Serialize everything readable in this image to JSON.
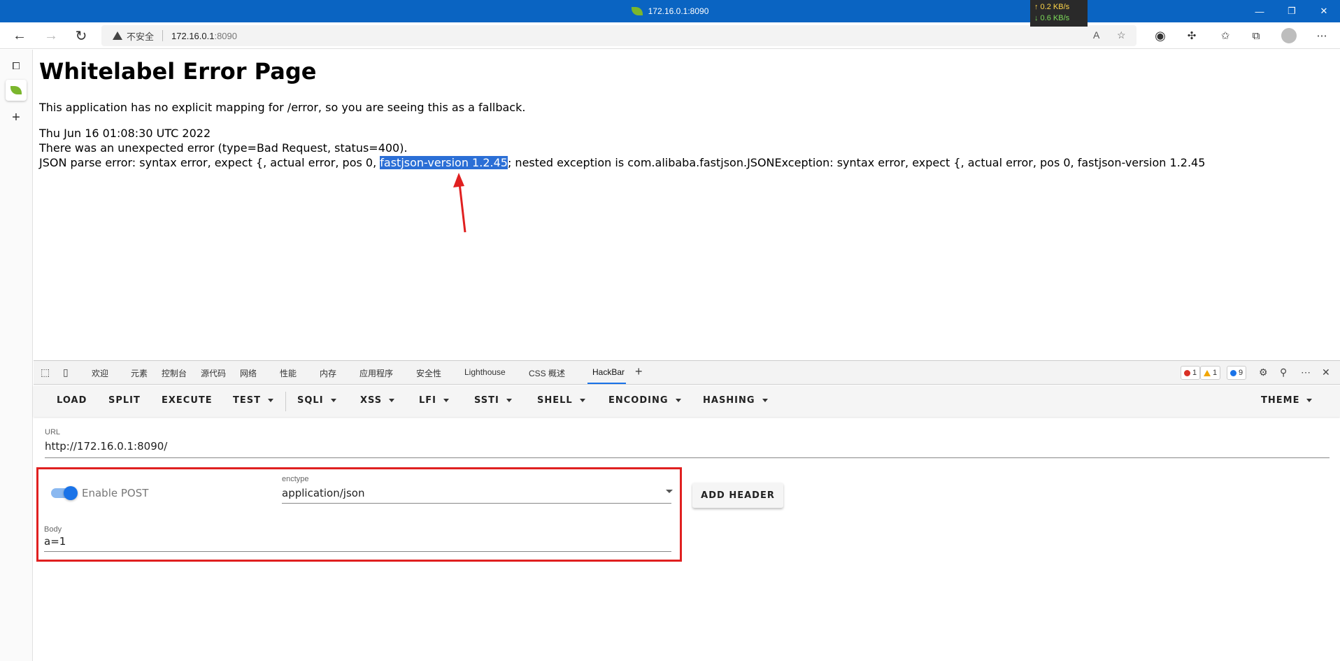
{
  "window": {
    "title": "172.16.0.1:8090",
    "net_up": "↑ 0.2 KB/s",
    "net_down": "↓ 0.6 KB/s",
    "minimize": "—",
    "restore": "❐",
    "close": "✕"
  },
  "addressbar": {
    "back": "←",
    "forward": "→",
    "reload": "↻",
    "insecure_label": "不安全",
    "url_host": "172.16.0.1",
    "url_port": ":8090"
  },
  "sidebar": {
    "add": "+"
  },
  "page": {
    "heading": "Whitelabel Error Page",
    "fallback_msg": "This application has no explicit mapping for /error, so you are seeing this as a fallback.",
    "timestamp": "Thu Jun 16 01:08:30 UTC 2022",
    "error_line": "There was an unexpected error (type=Bad Request, status=400).",
    "json_error_prefix": "JSON parse error: syntax error, expect {, actual error, pos 0, ",
    "json_error_highlight": "fastjson-version 1.2.45",
    "json_error_suffix": "; nested exception is com.alibaba.fastjson.JSONException: syntax error, expect {, actual error, pos 0, fastjson-version 1.2.45"
  },
  "devtools": {
    "tabs": [
      {
        "label": "欢迎"
      },
      {
        "label": "元素"
      },
      {
        "label": "控制台"
      },
      {
        "label": "源代码"
      },
      {
        "label": "网络"
      },
      {
        "label": "性能"
      },
      {
        "label": "内存"
      },
      {
        "label": "应用程序"
      },
      {
        "label": "安全性"
      },
      {
        "label": "Lighthouse"
      },
      {
        "label": "CSS 概述"
      },
      {
        "label": "HackBar"
      }
    ],
    "active_tab": "HackBar",
    "add_tab": "+",
    "errors_count": "1",
    "warnings_count": "1",
    "info_count": "9",
    "more": "⋯",
    "close": "✕"
  },
  "hackbar": {
    "toolbar": {
      "load": "LOAD",
      "split": "SPLIT",
      "execute": "EXECUTE",
      "test": "TEST",
      "sqli": "SQLI",
      "xss": "XSS",
      "lfi": "LFI",
      "ssti": "SSTI",
      "shell": "SHELL",
      "encoding": "ENCODING",
      "hashing": "HASHING",
      "theme": "THEME"
    },
    "url_label": "URL",
    "url_value": "http://172.16.0.1:8090/",
    "enable_post_label": "Enable POST",
    "enable_post": true,
    "enctype_label": "enctype",
    "enctype_value": "application/json",
    "add_header": "ADD HEADER",
    "body_label": "Body",
    "body_value": "a=1"
  },
  "colors": {
    "titlebar": "#0a64c2",
    "highlight": "#2b6fd6",
    "annotation_red": "#e02020",
    "toggle_blue": "#1a73e8"
  }
}
